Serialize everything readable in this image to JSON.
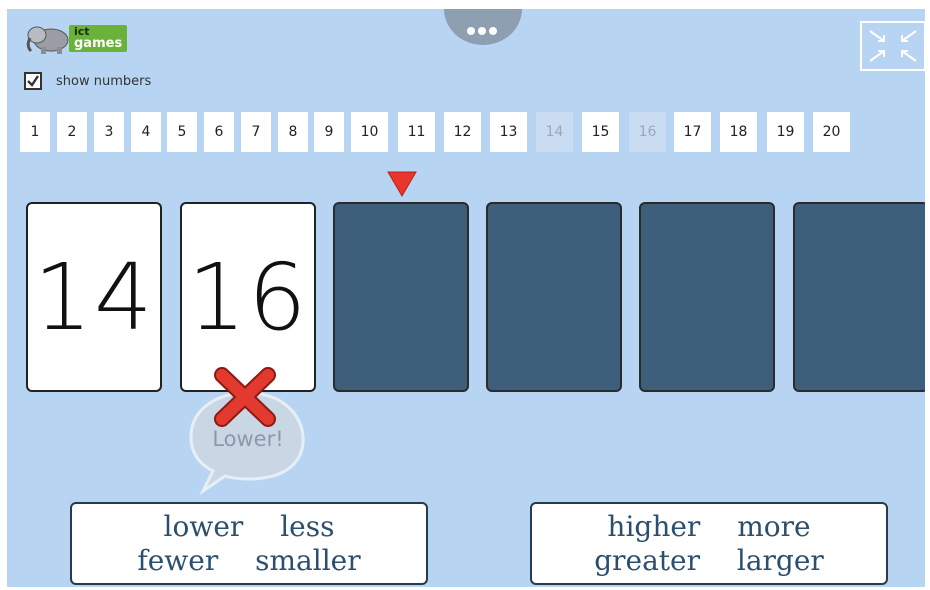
{
  "logo": {
    "line1": "ict",
    "line2": "games"
  },
  "options": {
    "show_numbers_label": "show numbers",
    "show_numbers_checked": true
  },
  "number_strip": [
    {
      "label": "1",
      "used": false
    },
    {
      "label": "2",
      "used": false
    },
    {
      "label": "3",
      "used": false
    },
    {
      "label": "4",
      "used": false
    },
    {
      "label": "5",
      "used": false
    },
    {
      "label": "6",
      "used": false
    },
    {
      "label": "7",
      "used": false
    },
    {
      "label": "8",
      "used": false
    },
    {
      "label": "9",
      "used": false
    },
    {
      "label": "10",
      "used": false
    },
    {
      "label": "11",
      "used": false
    },
    {
      "label": "12",
      "used": false
    },
    {
      "label": "13",
      "used": false
    },
    {
      "label": "14",
      "used": true
    },
    {
      "label": "15",
      "used": false
    },
    {
      "label": "16",
      "used": true
    },
    {
      "label": "17",
      "used": false
    },
    {
      "label": "18",
      "used": false
    },
    {
      "label": "19",
      "used": false
    },
    {
      "label": "20",
      "used": false
    }
  ],
  "cards": [
    {
      "value": "14",
      "revealed": true
    },
    {
      "value": "16",
      "revealed": true
    },
    {
      "value": "",
      "revealed": false
    },
    {
      "value": "",
      "revealed": false
    },
    {
      "value": "",
      "revealed": false
    },
    {
      "value": "",
      "revealed": false
    }
  ],
  "feedback": {
    "text": "Lower!"
  },
  "buttons": {
    "lower_words": [
      "lower",
      "less",
      "fewer",
      "smaller"
    ],
    "higher_words": [
      "higher",
      "more",
      "greater",
      "larger"
    ]
  },
  "colors": {
    "background": "#b7d5f2",
    "card_hidden": "#3e5f7b",
    "marker": "#e8362c",
    "wrong": "#e23a2e",
    "word_text": "#2d4f6e"
  },
  "icons": {
    "menu": "more-dots-icon",
    "fullscreen": "collapse-icon",
    "marker": "triangle-down-icon",
    "wrong": "cross-icon"
  }
}
